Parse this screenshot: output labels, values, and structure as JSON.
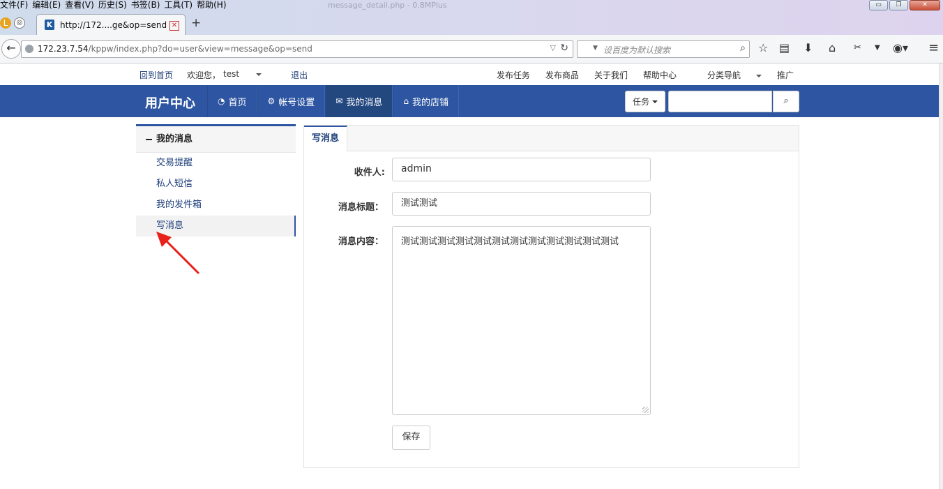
{
  "browser": {
    "menus": [
      "文件(F)",
      "编辑(E)",
      "查看(V)",
      "历史(S)",
      "书签(B)",
      "工具(T)",
      "帮助(H)"
    ],
    "faded_title": "message_detail.php - 0.8MPlus",
    "tab_title": "http://172....ge&op=send",
    "tab_favicon": "K",
    "new_tab": "+",
    "url_host": "172.23.7.54",
    "url_path": "/kppw/index.php?do=user&view=message&op=send",
    "search_placeholder": "设百度为默认搜索",
    "win_min": "▭",
    "win_max": "❐",
    "win_close": "✕"
  },
  "site_top": {
    "home": "回到首页",
    "welcome": "欢迎您，",
    "user": "test",
    "logout": "退出",
    "right_links": [
      "发布任务",
      "发布商品",
      "关于我们",
      "帮助中心",
      "分类导航",
      "推广"
    ]
  },
  "header": {
    "brand": "用户中心",
    "nav": [
      {
        "icon": "dashboard-icon",
        "glyph": "◔",
        "label": "首页"
      },
      {
        "icon": "gears-icon",
        "glyph": "⚙",
        "label": "帐号设置"
      },
      {
        "icon": "envelope-icon",
        "glyph": "✉",
        "label": "我的消息"
      },
      {
        "icon": "home-icon",
        "glyph": "⌂",
        "label": "我的店铺"
      }
    ],
    "search_scope": "任务",
    "search_value": "",
    "search_icon": "search-icon"
  },
  "sidebar": {
    "title": "我的消息",
    "items": [
      {
        "label": "交易提醒"
      },
      {
        "label": "私人短信"
      },
      {
        "label": "我的发件箱"
      },
      {
        "label": "写消息"
      }
    ]
  },
  "main": {
    "tab": "写消息",
    "recipient_label": "收件人:",
    "recipient_value": "admin",
    "subject_label": "消息标题：",
    "subject_value": "测试测试",
    "content_label": "消息内容：",
    "content_value": "测试测试测试测试测试测试测试测试测试测试测试测试",
    "save_label": "保存"
  },
  "colors": {
    "primary": "#2d55a1",
    "link": "#1e3f7a",
    "annotation_arrow": "#e8221b"
  }
}
